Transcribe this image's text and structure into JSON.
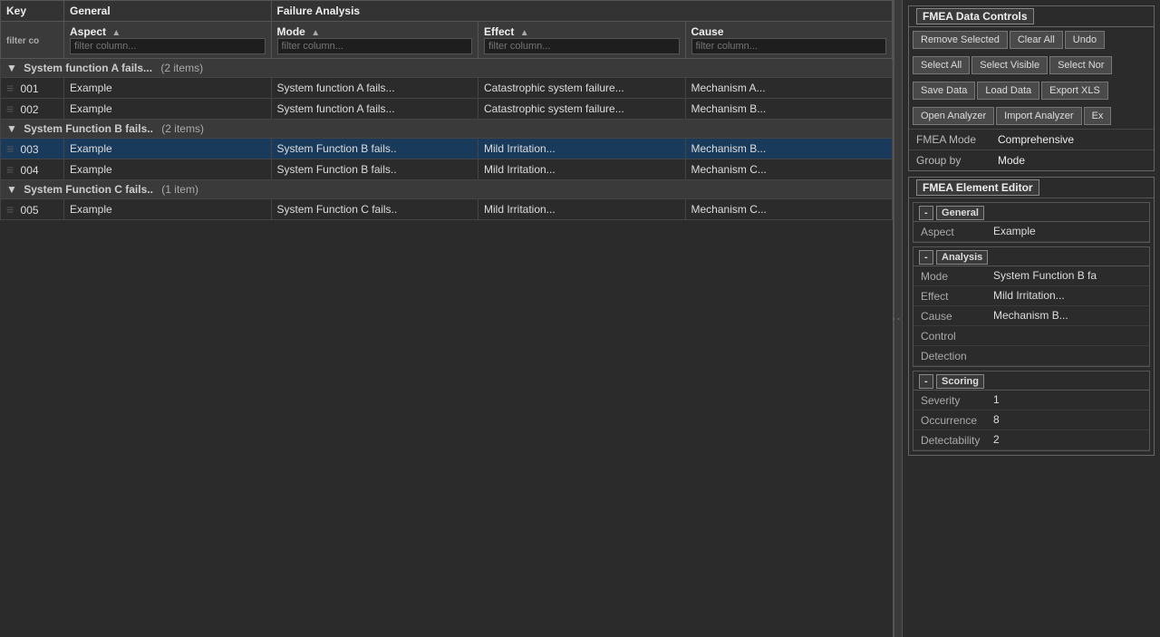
{
  "header": {
    "col_key": "Key",
    "col_general": "General",
    "col_failure": "Failure Analysis",
    "col_aspect": "Aspect",
    "col_mode": "Mode",
    "col_effect": "Effect",
    "col_cause": "Cause",
    "filter_placeholder": "filter column..."
  },
  "groups": [
    {
      "id": "group1",
      "label": "System function A fails...",
      "count": "(2 items)",
      "rows": [
        {
          "key": "001",
          "aspect": "Example",
          "mode": "System function A fails...",
          "effect": "Catastrophic system failure...",
          "cause": "Mechanism A...",
          "selected": false
        },
        {
          "key": "002",
          "aspect": "Example",
          "mode": "System function A fails...",
          "effect": "Catastrophic system failure...",
          "cause": "Mechanism B...",
          "selected": false
        }
      ]
    },
    {
      "id": "group2",
      "label": "System Function B fails..",
      "count": "(2 items)",
      "rows": [
        {
          "key": "003",
          "aspect": "Example",
          "mode": "System Function B fails..",
          "effect": "Mild Irritation...",
          "cause": "Mechanism B...",
          "selected": true
        },
        {
          "key": "004",
          "aspect": "Example",
          "mode": "System Function B fails..",
          "effect": "Mild Irritation...",
          "cause": "Mechanism C...",
          "selected": false
        }
      ]
    },
    {
      "id": "group3",
      "label": "System Function C fails..",
      "count": "(1 item)",
      "rows": [
        {
          "key": "005",
          "aspect": "Example",
          "mode": "System Function C fails..",
          "effect": "Mild Irritation...",
          "cause": "Mechanism C...",
          "selected": false
        }
      ]
    }
  ],
  "controls": {
    "title": "FMEA Data Controls",
    "buttons_row1": [
      "Remove Selected",
      "Clear All",
      "Undo"
    ],
    "buttons_row2": [
      "Select All",
      "Select Visible",
      "Select Nor"
    ],
    "buttons_row3": [
      "Save Data",
      "Load Data",
      "Export XLS"
    ],
    "buttons_row4": [
      "Open Analyzer",
      "Import Analyzer",
      "Ex"
    ],
    "fmea_mode_label": "FMEA Mode",
    "fmea_mode_value": "Comprehensive",
    "group_by_label": "Group by",
    "group_by_value": "Mode"
  },
  "editor": {
    "title": "FMEA Element Editor",
    "general": {
      "label": "General",
      "aspect_label": "Aspect",
      "aspect_value": "Example"
    },
    "analysis": {
      "label": "Analysis",
      "mode_label": "Mode",
      "mode_value": "System Function B fa",
      "effect_label": "Effect",
      "effect_value": "Mild Irritation...",
      "cause_label": "Cause",
      "cause_value": "Mechanism B...",
      "control_label": "Control",
      "control_value": "",
      "detection_label": "Detection",
      "detection_value": ""
    },
    "scoring": {
      "label": "Scoring",
      "severity_label": "Severity",
      "severity_value": "1",
      "occurrence_label": "Occurrence",
      "occurrence_value": "8",
      "detectability_label": "Detectability",
      "detectability_value": "2"
    }
  }
}
